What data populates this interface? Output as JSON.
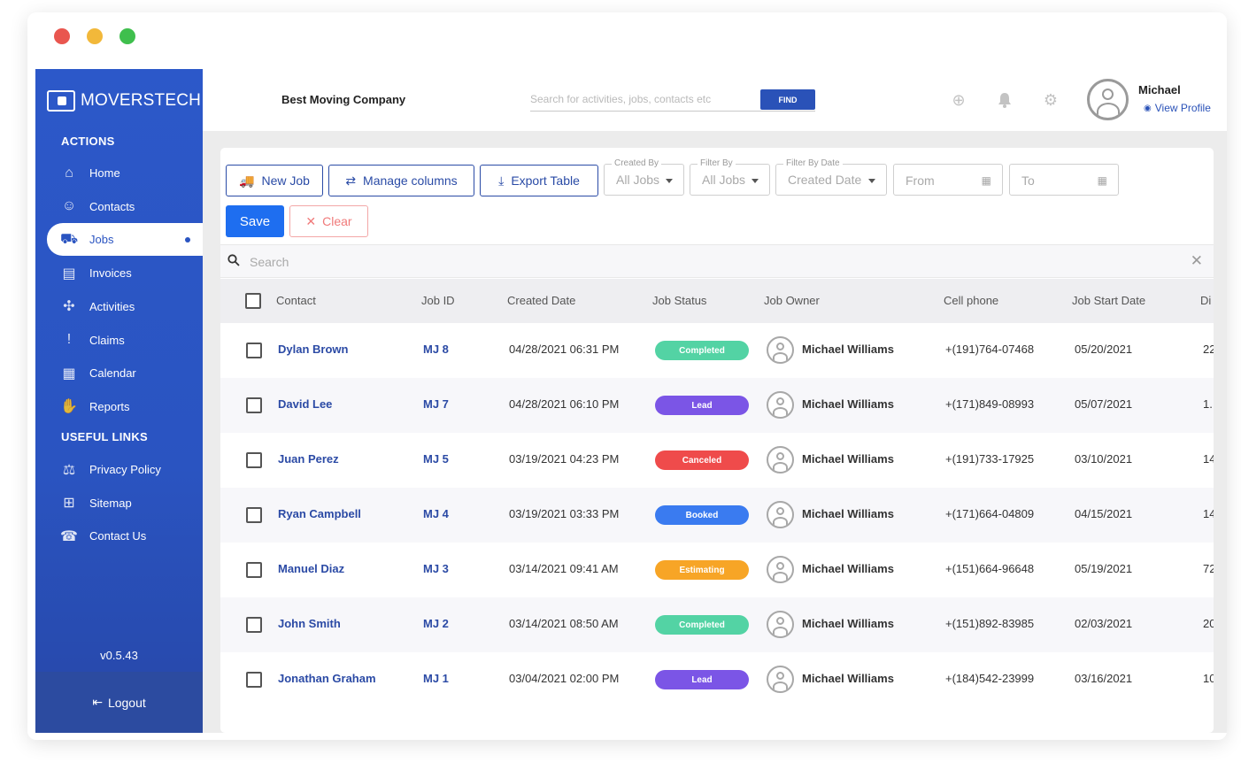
{
  "window": {
    "traffic_colors": [
      "#e9564f",
      "#f2b83a",
      "#3fbf4d"
    ]
  },
  "sidebar": {
    "logo": "MOVERSTECH",
    "sections": {
      "actions": "ACTIONS",
      "useful_links": "USEFUL LINKS"
    },
    "actions": [
      {
        "label": "Home",
        "icon": "home-icon"
      },
      {
        "label": "Contacts",
        "icon": "contacts-icon"
      },
      {
        "label": "Jobs",
        "icon": "truck-icon",
        "active": true
      },
      {
        "label": "Invoices",
        "icon": "invoice-icon"
      },
      {
        "label": "Activities",
        "icon": "activities-icon"
      },
      {
        "label": "Claims",
        "icon": "exclamation-icon"
      },
      {
        "label": "Calendar",
        "icon": "calendar-icon"
      },
      {
        "label": "Reports",
        "icon": "hand-icon"
      }
    ],
    "links": [
      {
        "label": "Privacy Policy",
        "icon": "privacy-icon"
      },
      {
        "label": "Sitemap",
        "icon": "sitemap-icon"
      },
      {
        "label": "Contact Us",
        "icon": "contact-us-icon"
      }
    ],
    "version": "v0.5.43",
    "logout": "Logout",
    "brand_color": "#2a54c1"
  },
  "header": {
    "company": "Best Moving Company",
    "search_placeholder": "Search for activities, jobs, contacts etc",
    "find": "FIND",
    "user_name": "Michael",
    "view_profile": "View Profile"
  },
  "toolbar": {
    "new_job": "New Job",
    "manage_columns": "Manage columns",
    "export_table": "Export Table",
    "created_by": {
      "label": "Created By",
      "value": "All Jobs"
    },
    "filter_by": {
      "label": "Filter By",
      "value": "All Jobs"
    },
    "filter_by_date": {
      "label": "Filter By Date",
      "value": "Created Date"
    },
    "from": "From",
    "to": "To",
    "save": "Save",
    "clear": "Clear"
  },
  "table": {
    "search_placeholder": "Search",
    "columns": [
      "Contact",
      "Job ID",
      "Created Date",
      "Job Status",
      "Job Owner",
      "Cell phone",
      "Job Start Date",
      "Di"
    ],
    "status_colors": {
      "Completed": "#53d3a4",
      "Lead": "#7b55e6",
      "Canceled": "#ef4b4b",
      "Booked": "#3a7bf0",
      "Estimating": "#f7a526"
    },
    "rows": [
      {
        "contact": "Dylan Brown",
        "job_id": "MJ 8",
        "created": "04/28/2021 06:31 PM",
        "status": "Completed",
        "owner": "Michael Williams",
        "phone": "+(191)764-07468",
        "start": "05/20/2021",
        "di": "22"
      },
      {
        "contact": "David Lee",
        "job_id": "MJ 7",
        "created": "04/28/2021 06:10 PM",
        "status": "Lead",
        "owner": "Michael Williams",
        "phone": "+(171)849-08993",
        "start": "05/07/2021",
        "di": "1."
      },
      {
        "contact": "Juan Perez",
        "job_id": "MJ 5",
        "created": "03/19/2021 04:23 PM",
        "status": "Canceled",
        "owner": "Michael Williams",
        "phone": "+(191)733-17925",
        "start": "03/10/2021",
        "di": "14"
      },
      {
        "contact": "Ryan Campbell",
        "job_id": "MJ 4",
        "created": "03/19/2021 03:33 PM",
        "status": "Booked",
        "owner": "Michael Williams",
        "phone": "+(171)664-04809",
        "start": "04/15/2021",
        "di": "14"
      },
      {
        "contact": "Manuel Diaz",
        "job_id": "MJ 3",
        "created": "03/14/2021 09:41 AM",
        "status": "Estimating",
        "owner": "Michael Williams",
        "phone": "+(151)664-96648",
        "start": "05/19/2021",
        "di": "72"
      },
      {
        "contact": "John Smith",
        "job_id": "MJ 2",
        "created": "03/14/2021 08:50 AM",
        "status": "Completed",
        "owner": "Michael Williams",
        "phone": "+(151)892-83985",
        "start": "02/03/2021",
        "di": "20"
      },
      {
        "contact": "Jonathan Graham",
        "job_id": "MJ 1",
        "created": "03/04/2021 02:00 PM",
        "status": "Lead",
        "owner": "Michael Williams",
        "phone": "+(184)542-23999",
        "start": "03/16/2021",
        "di": "10"
      }
    ]
  }
}
